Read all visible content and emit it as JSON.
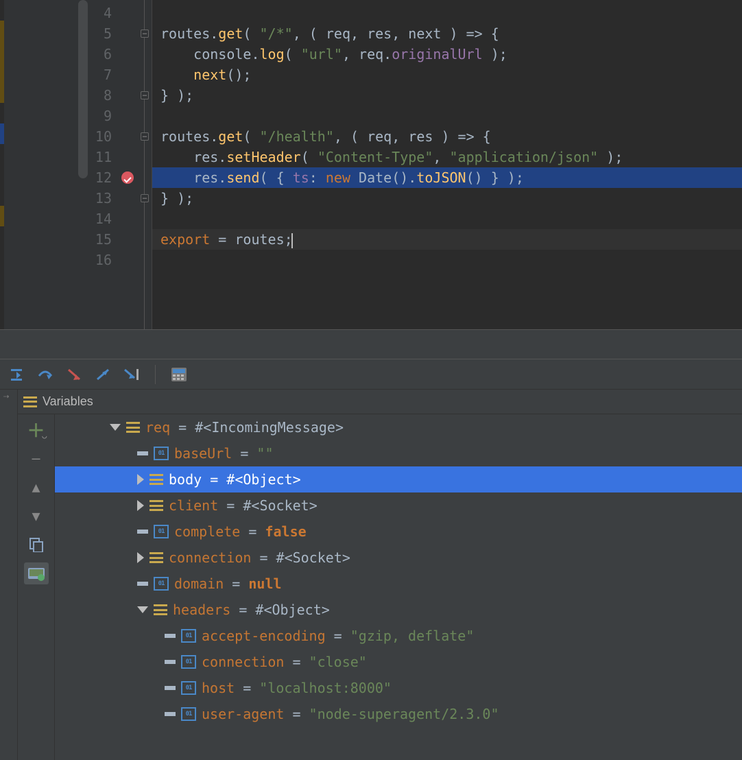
{
  "editor": {
    "lines": [
      {
        "num": 4
      },
      {
        "num": 5,
        "fold": "open",
        "tokens": [
          [
            "def",
            "routes"
          ],
          [
            "punc",
            "."
          ],
          [
            "call",
            "get"
          ],
          [
            "punc",
            "( "
          ],
          [
            "str",
            "\"/*\""
          ],
          [
            "punc",
            ", ( "
          ],
          [
            "def",
            "req"
          ],
          [
            "punc",
            ", "
          ],
          [
            "def",
            "res"
          ],
          [
            "punc",
            ", "
          ],
          [
            "def",
            "next"
          ],
          [
            "punc",
            " ) => {"
          ]
        ]
      },
      {
        "num": 6,
        "tokens": [
          [
            "def",
            "    console"
          ],
          [
            "punc",
            "."
          ],
          [
            "call",
            "log"
          ],
          [
            "punc",
            "( "
          ],
          [
            "str",
            "\"url\""
          ],
          [
            "punc",
            ", "
          ],
          [
            "def",
            "req"
          ],
          [
            "punc",
            "."
          ],
          [
            "purp",
            "originalUrl"
          ],
          [
            "punc",
            " );"
          ]
        ]
      },
      {
        "num": 7,
        "tokens": [
          [
            "def",
            "    "
          ],
          [
            "call",
            "next"
          ],
          [
            "punc",
            "();"
          ]
        ]
      },
      {
        "num": 8,
        "fold": "close",
        "tokens": [
          [
            "punc",
            "} );"
          ]
        ]
      },
      {
        "num": 9
      },
      {
        "num": 10,
        "fold": "open",
        "tokens": [
          [
            "def",
            "routes"
          ],
          [
            "punc",
            "."
          ],
          [
            "call",
            "get"
          ],
          [
            "punc",
            "( "
          ],
          [
            "str",
            "\"/health\""
          ],
          [
            "punc",
            ", ( "
          ],
          [
            "def",
            "req"
          ],
          [
            "punc",
            ", "
          ],
          [
            "def",
            "res"
          ],
          [
            "punc",
            " ) => {"
          ]
        ]
      },
      {
        "num": 11,
        "tokens": [
          [
            "def",
            "    res"
          ],
          [
            "punc",
            "."
          ],
          [
            "call",
            "setHeader"
          ],
          [
            "punc",
            "( "
          ],
          [
            "str",
            "\"Content-Type\""
          ],
          [
            "punc",
            ", "
          ],
          [
            "str",
            "\"application/json\""
          ],
          [
            "punc",
            " );"
          ]
        ]
      },
      {
        "num": 12,
        "breakpoint": true,
        "current": true,
        "tokens": [
          [
            "def",
            "    res"
          ],
          [
            "punc",
            "."
          ],
          [
            "call",
            "send"
          ],
          [
            "punc",
            "( { "
          ],
          [
            "purp",
            "ts"
          ],
          [
            "punc",
            ": "
          ],
          [
            "key",
            "new "
          ],
          [
            "def",
            "Date"
          ],
          [
            "punc",
            "()."
          ],
          [
            "call",
            "toJSON"
          ],
          [
            "punc",
            "() } );"
          ]
        ]
      },
      {
        "num": 13,
        "fold": "close",
        "tokens": [
          [
            "punc",
            "} );"
          ]
        ]
      },
      {
        "num": 14
      },
      {
        "num": 15,
        "exec": true,
        "tokens": [
          [
            "key",
            "export"
          ],
          [
            "def",
            " = routes"
          ],
          [
            "punc",
            ";"
          ]
        ]
      },
      {
        "num": 16
      }
    ]
  },
  "debug_toolbar": [
    "show-execution-point",
    "step-over",
    "step-into",
    "step-out",
    "run-to-cursor",
    "evaluate-expression"
  ],
  "variables_title": "Variables",
  "variables": [
    {
      "lvl": 1,
      "exp": "down",
      "icon": "obj",
      "name": "req",
      "sep": " = ",
      "val": "#<IncomingMessage>"
    },
    {
      "lvl": 2,
      "exp": "",
      "icon": "prim",
      "name": "baseUrl",
      "sep": " = ",
      "val": "\"\"",
      "str": true
    },
    {
      "lvl": 2,
      "exp": "right",
      "icon": "obj",
      "name": "body",
      "sep": " = ",
      "val": "#<Object>",
      "selected": true
    },
    {
      "lvl": 2,
      "exp": "right",
      "icon": "obj",
      "name": "client",
      "sep": " = ",
      "val": "#<Socket>"
    },
    {
      "lvl": 2,
      "exp": "",
      "icon": "prim",
      "name": "complete",
      "sep": " = ",
      "val": "false",
      "key": true
    },
    {
      "lvl": 2,
      "exp": "right",
      "icon": "obj",
      "name": "connection",
      "sep": " = ",
      "val": "#<Socket>"
    },
    {
      "lvl": 2,
      "exp": "",
      "icon": "prim",
      "name": "domain",
      "sep": " = ",
      "val": "null",
      "key": true
    },
    {
      "lvl": 2,
      "exp": "down",
      "icon": "obj",
      "name": "headers",
      "sep": " = ",
      "val": "#<Object>"
    },
    {
      "lvl": 3,
      "exp": "",
      "icon": "prim",
      "name": "accept-encoding",
      "sep": " = ",
      "val": "\"gzip, deflate\"",
      "str": true
    },
    {
      "lvl": 3,
      "exp": "",
      "icon": "prim",
      "name": "connection",
      "sep": " = ",
      "val": "\"close\"",
      "str": true
    },
    {
      "lvl": 3,
      "exp": "",
      "icon": "prim",
      "name": "host",
      "sep": " = ",
      "val": "\"localhost:8000\"",
      "str": true
    },
    {
      "lvl": 3,
      "exp": "",
      "icon": "prim",
      "name": "user-agent",
      "sep": " = ",
      "val": "\"node-superagent/2.3.0\"",
      "str": true
    }
  ],
  "prim_label": "10\n01"
}
